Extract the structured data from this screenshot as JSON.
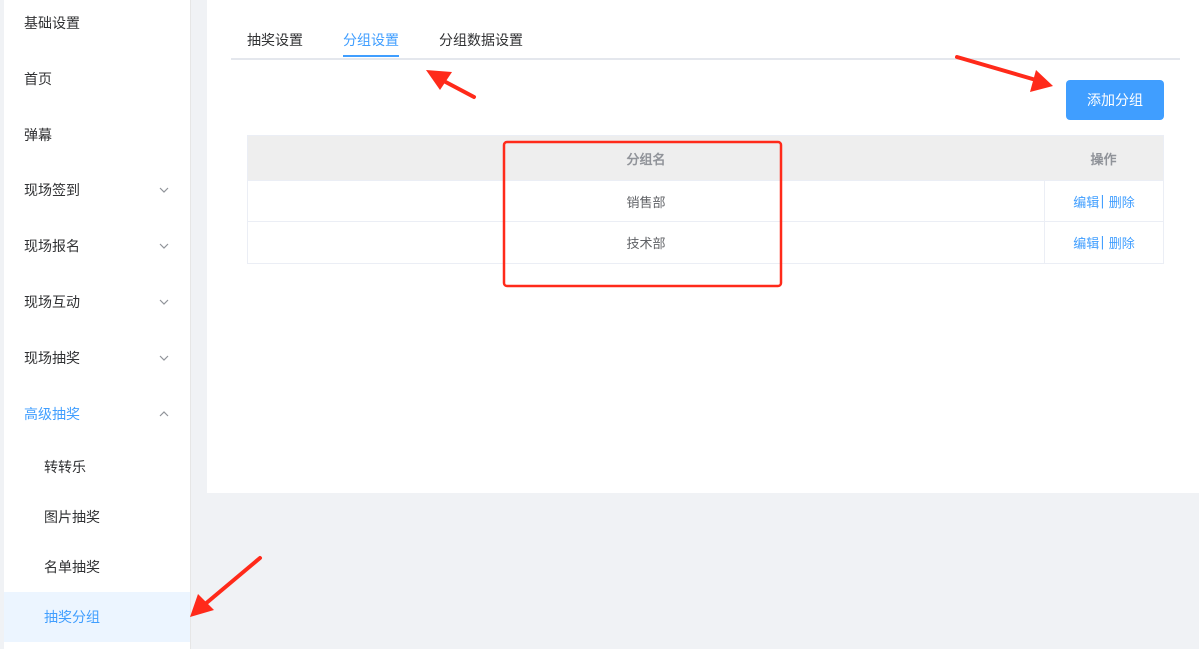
{
  "sidebar": {
    "items": [
      {
        "label": "基础设置"
      },
      {
        "label": "首页"
      },
      {
        "label": "弹幕"
      },
      {
        "label": "现场签到"
      },
      {
        "label": "现场报名"
      },
      {
        "label": "现场互动"
      },
      {
        "label": "现场抽奖"
      },
      {
        "label": "高级抽奖"
      }
    ],
    "sub_items": [
      {
        "label": "转转乐"
      },
      {
        "label": "图片抽奖"
      },
      {
        "label": "名单抽奖"
      },
      {
        "label": "抽奖分组"
      }
    ],
    "active_sub": "抽奖分组"
  },
  "tabs": [
    {
      "label": "抽奖设置"
    },
    {
      "label": "分组设置"
    },
    {
      "label": "分组数据设置"
    }
  ],
  "active_tab": "分组设置",
  "toolbar": {
    "add_label": "添加分组"
  },
  "table": {
    "headers": {
      "name": "分组名",
      "ops": "操作"
    },
    "rows": [
      {
        "name": "销售部",
        "edit": "编辑",
        "delete": "删除"
      },
      {
        "name": "技术部",
        "edit": "编辑",
        "delete": "删除"
      }
    ],
    "sep": "|"
  },
  "colors": {
    "accent": "#409eff",
    "annotation": "#ff2a1a"
  }
}
